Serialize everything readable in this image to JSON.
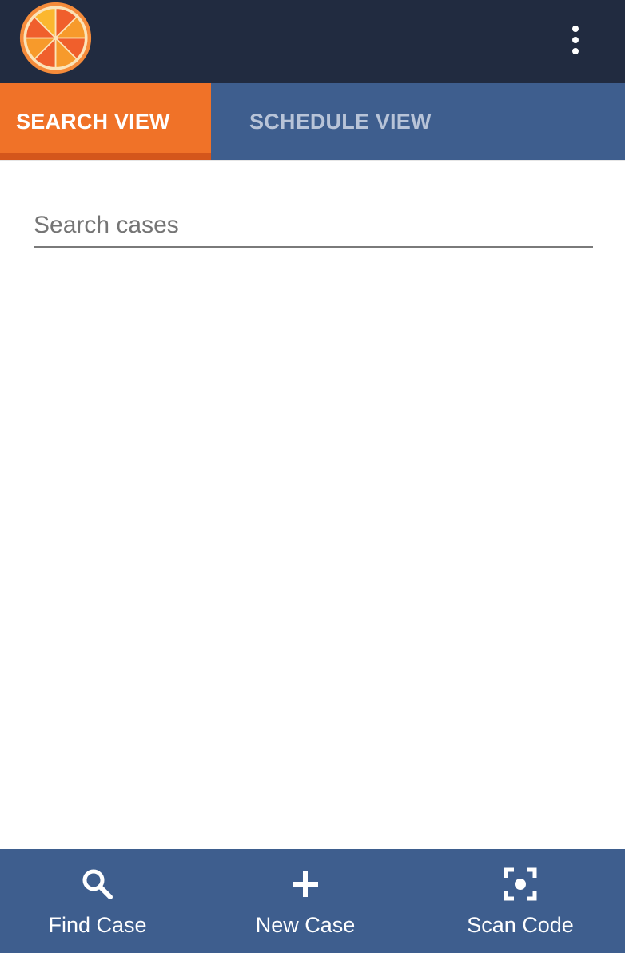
{
  "header": {
    "logo": "orange-slice-logo",
    "menu_icon": "more-vertical-icon"
  },
  "tabs": [
    {
      "label": "SEARCH VIEW",
      "active": true
    },
    {
      "label": "SCHEDULE VIEW",
      "active": false
    }
  ],
  "search": {
    "placeholder": "Search cases",
    "value": ""
  },
  "bottom_nav": [
    {
      "label": "Find Case",
      "icon": "search-icon"
    },
    {
      "label": "New Case",
      "icon": "plus-icon"
    },
    {
      "label": "Scan Code",
      "icon": "scan-code-icon"
    }
  ],
  "colors": {
    "header_bg": "#212b40",
    "tab_bar_bg": "#3e5e8e",
    "active_tab_bg": "#f07228",
    "active_tab_indicator": "#d4561b",
    "inactive_tab_text": "#b8c4d8",
    "bottom_bar_bg": "#3e5e8e"
  }
}
